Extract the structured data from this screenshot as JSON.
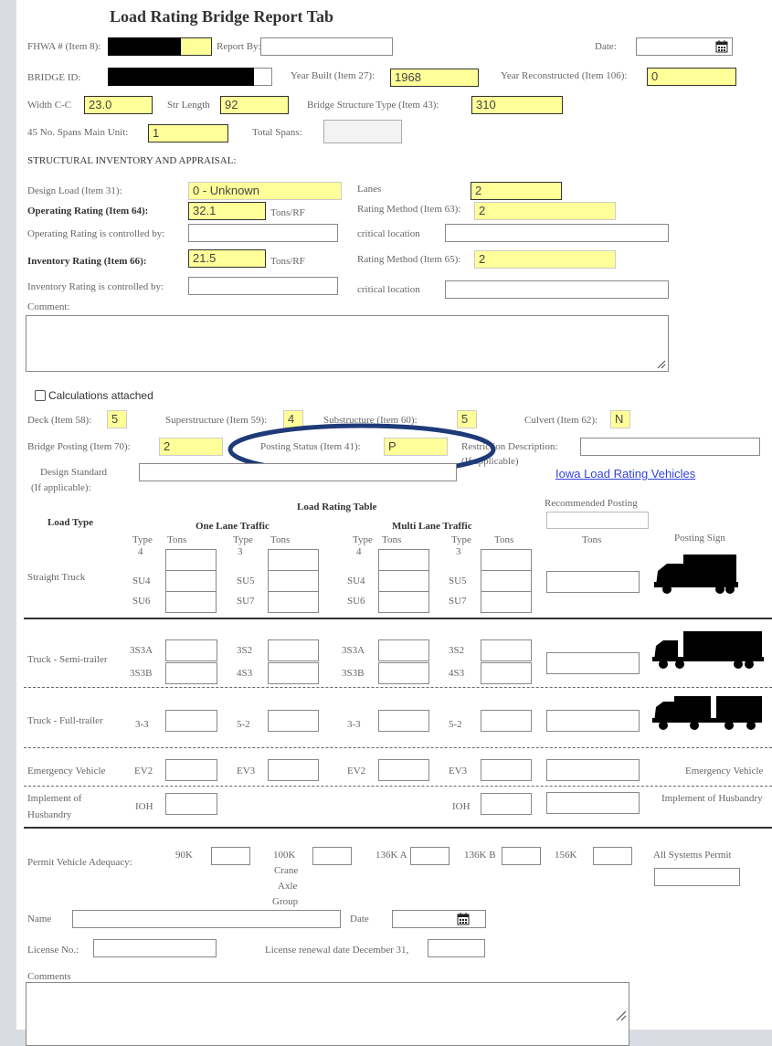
{
  "title": "Load Rating Bridge Report Tab",
  "fhwa_label": "FHWA # (Item 8):",
  "report_by_label": "Report By:",
  "date_label": "Date:",
  "bridge_id_label": "BRIDGE ID:",
  "year_built_label": "Year Built (Item 27):",
  "year_built": "1968",
  "year_recon_label": "Year Reconstructed (Item 106):",
  "year_recon": "0",
  "width_label": "Width C-C",
  "width": "23.0",
  "str_length_label": "Str Length",
  "str_length": "92",
  "structure_type_label": "Bridge Structure Type (Item 43):",
  "structure_type": "310",
  "spans_label": "45 No. Spans Main Unit:",
  "spans": "1",
  "total_spans_label": "Total Spans:",
  "structural_heading": "STRUCTURAL INVENTORY AND APPRAISAL:",
  "design_load_label": "Design Load (Item 31):",
  "design_load": "0 - Unknown",
  "lanes_label": "Lanes",
  "lanes": "2",
  "operating_label": "Operating Rating (Item 64):",
  "operating": "32.1",
  "tons_rf": "Tons/RF",
  "rating_method_63_label": "Rating Method (Item 63):",
  "rating_method_63": "2",
  "operating_controlled_label": "Operating Rating is controlled by:",
  "critical_location_label": "critical location",
  "inventory_label": "Inventory Rating (Item 66):",
  "inventory": "21.5",
  "rating_method_65_label": "Rating Method (Item 65):",
  "rating_method_65": "2",
  "inventory_controlled_label": "Inventory Rating is controlled by:",
  "comment_label": "Comment:",
  "calc_attached_label": "Calculations attached",
  "deck_label": "Deck (Item 58):",
  "deck": "5",
  "super_label": "Superstructure (Item 59):",
  "super": "4",
  "sub_label": "Substructure (Item 60):",
  "sub": "5",
  "culvert_label": "Culvert (Item 62):",
  "culvert": "N",
  "posting_label": "Bridge Posting (Item 70):",
  "posting": "2",
  "posting_status_label": "Posting Status (Item 41):",
  "posting_status": "P",
  "restriction_label": "Restriction Description:",
  "if_applicable": "(If applicable)",
  "design_standard_label": "Design Standard",
  "design_standard_sub": "(If applicable):",
  "iowa_link": "Iowa Load Rating Vehicles",
  "table_title": "Load Rating Table",
  "recommended_posting": "Recommended Posting",
  "load_type": "Load Type",
  "one_lane": "One Lane Traffic",
  "multi_lane": "Multi Lane Traffic",
  "type_label": "Type",
  "tons_label": "Tons",
  "posting_sign": "Posting Sign",
  "straight_truck": "Straight Truck",
  "semi_trailer": "Truck - Semi-trailer",
  "full_trailer": "Truck - Full-trailer",
  "emergency": "Emergency Vehicle",
  "implement_1": "Implement of",
  "implement_2": "Husbandry",
  "implement_full": "Implement of Husbandry",
  "v": {
    "t4": "4",
    "t3": "3",
    "su4": "SU4",
    "su5": "SU5",
    "su6": "SU6",
    "su7": "SU7",
    "s3a": "3S3A",
    "s3b": "3S3B",
    "s2": "3S2",
    "s43": "4S3",
    "fa": "3-3",
    "fb": "5-2",
    "ev2": "EV2",
    "ev3": "EV3",
    "ioh": "IOH"
  },
  "permit_label": "Permit Vehicle Adequacy:",
  "p90": "90K",
  "p100a": "100K",
  "p100b": "Crane",
  "p100c": "Axle",
  "p100d": "Group",
  "p136a": "136K A",
  "p136b": "136K B",
  "p156": "156K",
  "all_systems": "All Systems Permit",
  "name_label": "Name",
  "date2_label": "Date",
  "license_label": "License No.:",
  "license_renewal_label": "License renewal date December 31,",
  "comments_label": "Comments",
  "colors": {
    "highlight": "#ffff99",
    "annotation": "#1f3a78",
    "link": "#3344dd"
  },
  "icons": [
    "calendar-icon",
    "straight-truck-icon",
    "semi-trailer-icon",
    "full-trailer-icon",
    "resize-handle-icon"
  ]
}
